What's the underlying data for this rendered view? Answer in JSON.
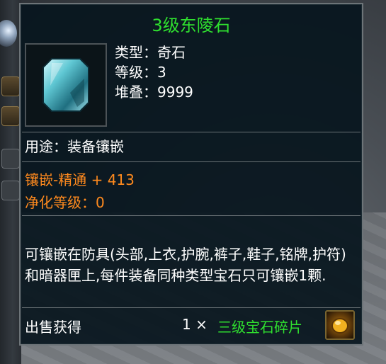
{
  "item": {
    "name": "3级东陵石",
    "type_label": "类型：",
    "type_value": "奇石",
    "level_label": "等级：",
    "level_value": "3",
    "stack_label": "堆叠：",
    "stack_value": "9999",
    "usage_label": "用途：",
    "usage_value": "装备镶嵌",
    "inlay_bonus": "镶嵌-精通 + 413",
    "refine_label": "净化等级：",
    "refine_value": "0",
    "description": "可镶嵌在防具(头部,上衣,护腕,裤子,鞋子,铭牌,护符)和暗器匣上,每件装备同种类型宝石只可镶嵌1颗.",
    "sell_label": "出售获得",
    "sell_quantity": "1 ×",
    "sell_item": "三级宝石碎片"
  },
  "colors": {
    "title_green": "#2fe02f",
    "bonus_orange": "#ff8a1e",
    "panel_bg": "#08161e",
    "text_white": "#ffffff"
  },
  "icons": {
    "item_icon": "turquoise-gem-icon",
    "sell_icon": "gem-fragment-icon"
  }
}
